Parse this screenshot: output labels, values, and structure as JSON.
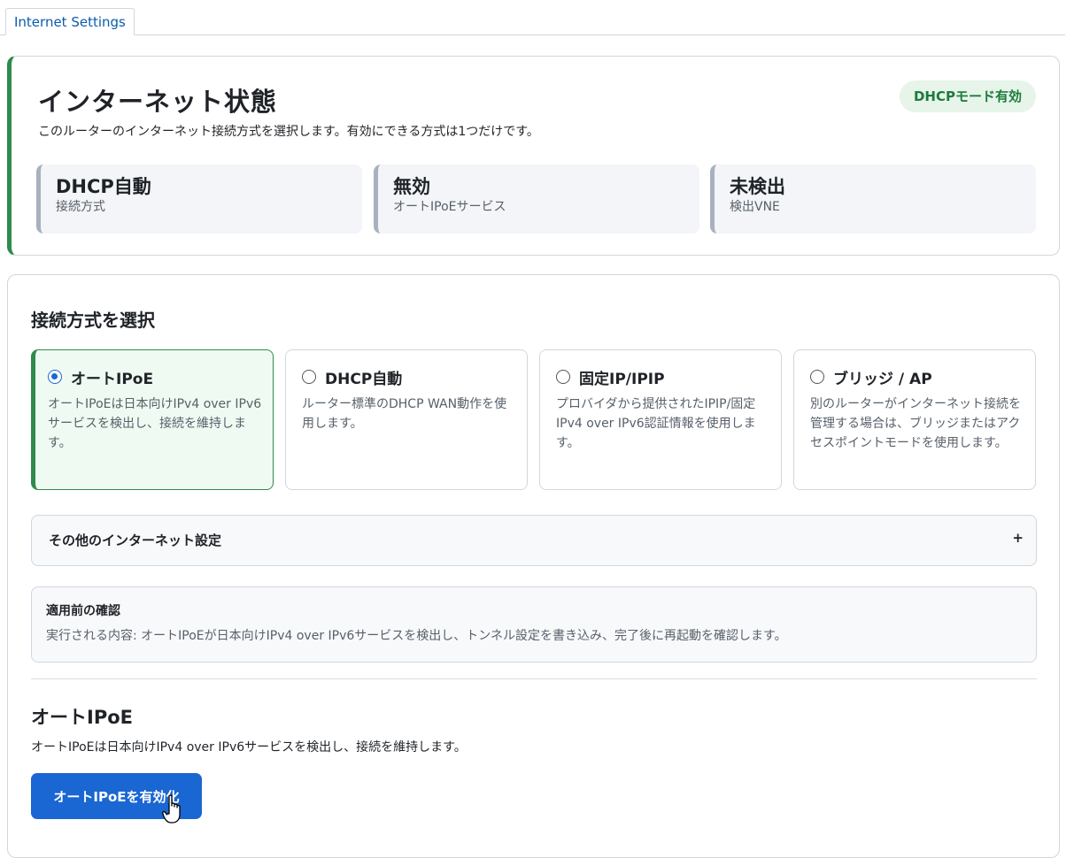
{
  "tabs": [
    {
      "label": "Internet Settings"
    }
  ],
  "status": {
    "title": "インターネット状態",
    "subtitle": "このルーターのインターネット接続方式を選択します。有効にできる方式は1つだけです。",
    "badge": "DHCPモード有効",
    "stats": [
      {
        "value": "DHCP自動",
        "label": "接続方式"
      },
      {
        "value": "無効",
        "label": "オートIPoEサービス"
      },
      {
        "value": "未検出",
        "label": "検出VNE"
      }
    ]
  },
  "methods": {
    "title": "接続方式を選択",
    "selected_index": 0,
    "options": [
      {
        "label": "オートIPoE",
        "description": "オートIPoEは日本向けIPv4 over IPv6サービスを検出し、接続を維持します。"
      },
      {
        "label": "DHCP自動",
        "description": "ルーター標準のDHCP WAN動作を使用します。"
      },
      {
        "label": "固定IP/IPIP",
        "description": "プロバイダから提供されたIPIP/固定IPv4 over IPv6認証情報を使用します。"
      },
      {
        "label": "ブリッジ / AP",
        "description": "別のルーターがインターネット接続を管理する場合は、ブリッジまたはアクセスポイントモードを使用します。"
      }
    ]
  },
  "other_settings": {
    "label": "その他のインターネット設定",
    "toggle": "+"
  },
  "confirm": {
    "title": "適用前の確認",
    "text": "実行される内容: オートIPoEが日本向けIPv4 over IPv6サービスを検出し、トンネル設定を書き込み、完了後に再起動を確認します。"
  },
  "action": {
    "title": "オートIPoE",
    "description": "オートIPoEは日本向けIPv4 over IPv6サービスを検出し、接続を維持します。",
    "button_label": "オートIPoEを有効化"
  },
  "colors": {
    "accent": "#2f8a4c",
    "primary": "#1a66d2",
    "badge_bg": "#e6f4ea"
  }
}
